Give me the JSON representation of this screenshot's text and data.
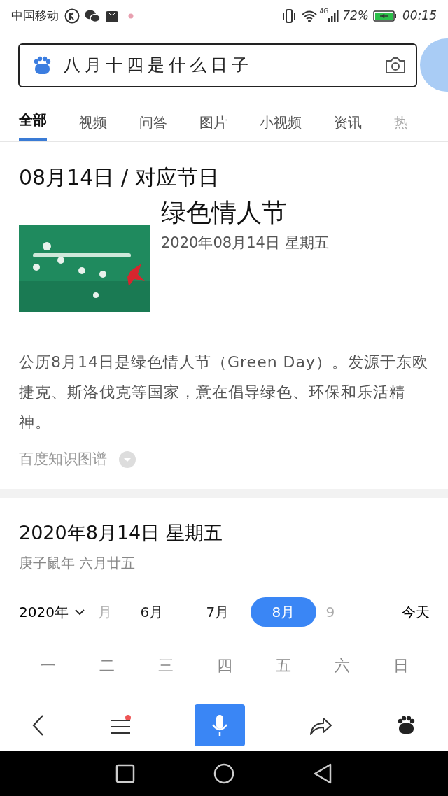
{
  "status_bar": {
    "carrier": "中国移动",
    "network": "4G",
    "battery": "72%",
    "time": "00:15"
  },
  "search": {
    "value": "八月十四是什么日子"
  },
  "tabs": [
    {
      "label": "全部",
      "selected": true
    },
    {
      "label": "视频",
      "selected": false
    },
    {
      "label": "问答",
      "selected": false
    },
    {
      "label": "图片",
      "selected": false
    },
    {
      "label": "小视频",
      "selected": false
    },
    {
      "label": "资讯",
      "selected": false
    },
    {
      "label": "热",
      "selected": false,
      "faded": true
    }
  ],
  "holiday_card": {
    "heading": "08月14日 / 对应节日",
    "name": "绿色情人节",
    "date": "2020年08月14日 星期五",
    "description": "公历8月14日是绿色情人节（Green Day）。发源于东欧捷克、斯洛伐克等国家，意在倡导绿色、环保和乐活精神。",
    "source": "百度知识图谱"
  },
  "calendar_card": {
    "date": "2020年8月14日 星期五",
    "lunar": "庚子鼠年 六月廿五",
    "year": "2020年",
    "months": [
      {
        "label": "月",
        "selected": false,
        "faded": true
      },
      {
        "label": "6月",
        "selected": false,
        "faded": false
      },
      {
        "label": "7月",
        "selected": false,
        "faded": false
      },
      {
        "label": "8月",
        "selected": true,
        "faded": false
      },
      {
        "label": "9",
        "selected": false,
        "faded": true
      }
    ],
    "today": "今天",
    "weekdays": [
      "一",
      "二",
      "三",
      "四",
      "五",
      "六",
      "日"
    ]
  },
  "bottom_bar": {
    "menu_badge": true
  }
}
